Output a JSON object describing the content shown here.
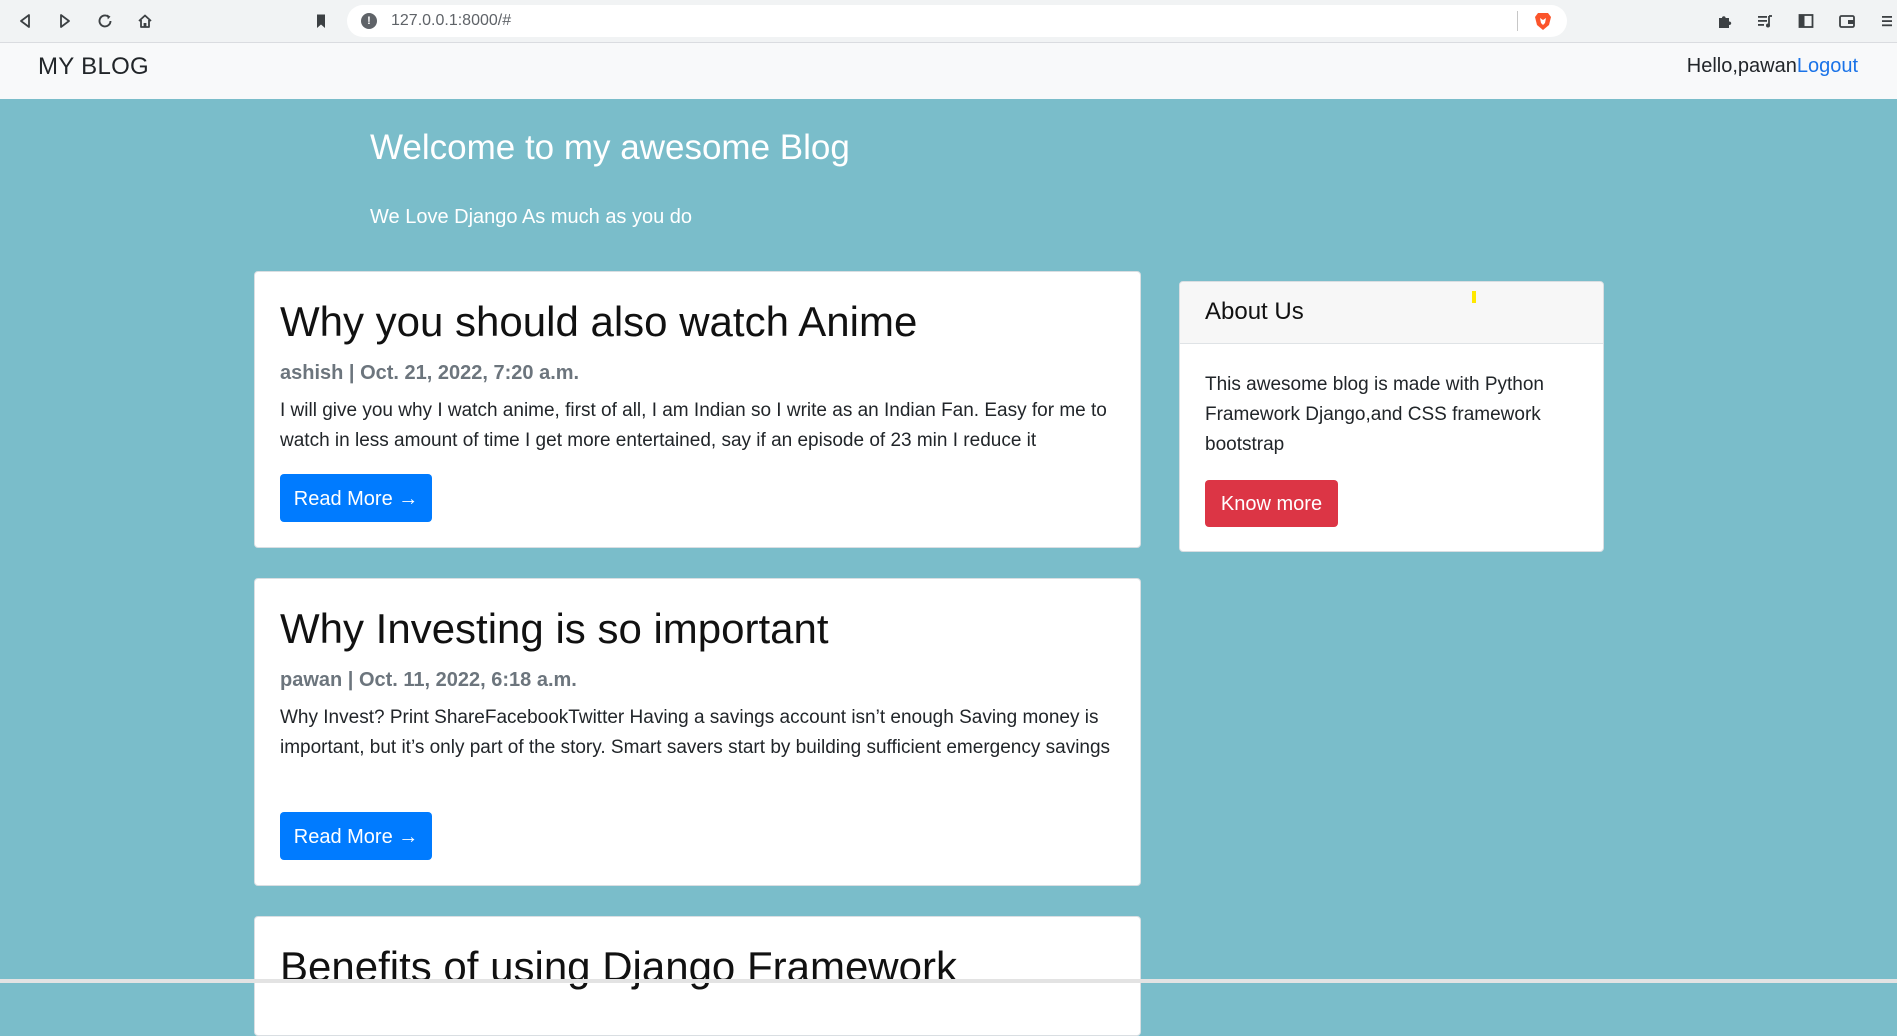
{
  "browser": {
    "url": "127.0.0.1:8000/#",
    "info_icon": "!",
    "nav_icons": [
      "back-icon",
      "forward-icon",
      "reload-icon",
      "home-icon",
      "bookmark-icon"
    ],
    "toolbar_icons": [
      "brave-shield-icon",
      "extensions-icon",
      "playlist-icon",
      "sidebar-icon",
      "wallet-icon",
      "menu-icon"
    ]
  },
  "navbar": {
    "brand": "MY BLOG",
    "greeting": "Hello,pawan",
    "logout": "Logout"
  },
  "hero": {
    "title": "Welcome to my awesome Blog",
    "subtitle": "We Love Django As much as you do"
  },
  "posts": [
    {
      "title": "Why you should also watch Anime",
      "meta": "ashish | Oct. 21, 2022, 7:20 a.m.",
      "excerpt": "I will give you why I watch anime, first of all, I am Indian so I write as an Indian Fan. Easy for me to watch in less amount of time I get more entertained, say if an episode of 23 min I reduce it",
      "button": "Read More →"
    },
    {
      "title": "Why Investing is so important",
      "meta": "pawan | Oct. 11, 2022, 6:18 a.m.",
      "excerpt": "Why Invest? Print ShareFacebookTwitter Having a savings account isn’t enough Saving money is important, but it’s only part of the story. Smart savers start by building sufficient emergency savings",
      "button": "Read More →"
    },
    {
      "title": "Benefits of using Django Framework"
    }
  ],
  "about": {
    "title": "About Us",
    "text": "This awesome blog is made with Python Framework Django,and CSS framework bootstrap",
    "button": "Know more"
  },
  "colors": {
    "page_bg": "#7abdca",
    "primary_button": "#007bff",
    "danger_button": "#dc3545",
    "logout_link": "#1a73e8"
  }
}
